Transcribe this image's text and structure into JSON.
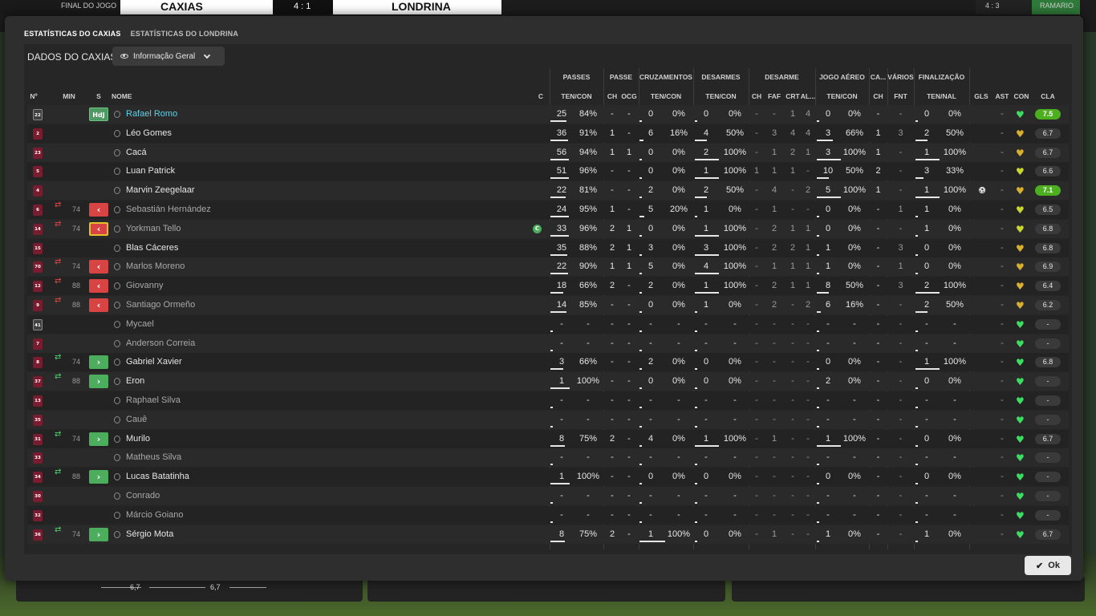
{
  "scoreboard": {
    "label": "FINAL DO JOGO",
    "home": "CAXIAS",
    "score": "4 : 1",
    "away": "LONDRINA",
    "right_label": "RAMARIO",
    "right_score": "4 : 3"
  },
  "tabs": [
    {
      "label": "ESTATÍSTICAS DO CAXIAS",
      "active": true
    },
    {
      "label": "ESTATÍSTICAS DO LONDRINA",
      "active": false
    }
  ],
  "title": "DADOS DO CAXIAS",
  "dropdown": {
    "label": "Informação Geral"
  },
  "groups": {
    "passes": "PASSES",
    "passe": "PASSE",
    "cruzamentos": "CRUZAMENTOS",
    "desarmes": "DESARMES",
    "desarme": "DESARME",
    "jogo_aereo": "JOGO AÉREO",
    "ca": "CA...",
    "varios": "VÁRIOS",
    "finalizacao": "FINALIZAÇÃO"
  },
  "columns": {
    "no": "Nº",
    "min": "MIN",
    "s": "S",
    "nome": "NOME",
    "c": "C",
    "passes_tc": "TEN/CON",
    "passe_ch": "CH",
    "passe_ocg": "OCG",
    "cruz_tc": "TEN/CON",
    "des_tc": "TEN/CON",
    "desarme_ch": "CH",
    "desarme_faf": "FAF",
    "desarme_crt": "CRT",
    "desarme_al": "AL...",
    "aereo_tc": "TEN/CON",
    "ca_ch": "CH",
    "varios_fnt": "FNT",
    "fin_tn": "TEN/NAL",
    "gls": "GLS",
    "ast": "AST",
    "con": "CON",
    "cla": "CLA"
  },
  "players": [
    {
      "no": "22",
      "gk": true,
      "min": "",
      "sub": "",
      "badge": "HdJ",
      "name": "Rafael Romo",
      "style": "hl",
      "cap": false,
      "pt": "25",
      "pp": "84%",
      "pbar": 0.84,
      "pch": "-",
      "pocg": "-",
      "ct": "0",
      "cp": "0%",
      "cbar": 0,
      "dt": "0",
      "dp": "0%",
      "dbar": 0,
      "dch": "-",
      "faf": "-",
      "crt": "1",
      "al": "4",
      "at": "0",
      "ap": "0%",
      "abar": 0,
      "cach": "-",
      "fnt": "-",
      "ft": "0",
      "fp": "0%",
      "fbar": 0,
      "gls": "",
      "ast": "-",
      "heart": "#3ddc62",
      "rating": "7.5",
      "top": true
    },
    {
      "no": "2",
      "gk": false,
      "min": "",
      "sub": "",
      "badge": "",
      "name": "Léo Gomes",
      "style": "",
      "cap": false,
      "pt": "36",
      "pp": "91%",
      "pbar": 0.91,
      "pch": "1",
      "pocg": "-",
      "ct": "6",
      "cp": "16%",
      "cbar": 0.16,
      "dt": "4",
      "dp": "50%",
      "dbar": 0.5,
      "dch": "-",
      "faf": "3",
      "crt": "4",
      "al": "4",
      "at": "3",
      "ap": "66%",
      "abar": 0.66,
      "cach": "1",
      "fnt": "3",
      "ft": "2",
      "fp": "50%",
      "fbar": 0.5,
      "gls": "",
      "ast": "-",
      "heart": "#d8b030",
      "rating": "6.7",
      "top": false
    },
    {
      "no": "23",
      "gk": false,
      "min": "",
      "sub": "",
      "badge": "",
      "name": "Cacá",
      "style": "",
      "cap": false,
      "pt": "56",
      "pp": "94%",
      "pbar": 0.94,
      "pch": "1",
      "pocg": "1",
      "ct": "0",
      "cp": "0%",
      "cbar": 0,
      "dt": "2",
      "dp": "100%",
      "dbar": 1,
      "dch": "-",
      "faf": "1",
      "crt": "2",
      "al": "1",
      "at": "3",
      "ap": "100%",
      "abar": 1,
      "cach": "1",
      "fnt": "-",
      "ft": "1",
      "fp": "100%",
      "fbar": 1,
      "gls": "",
      "ast": "-",
      "heart": "#d8b030",
      "rating": "6.7",
      "top": false
    },
    {
      "no": "5",
      "gk": false,
      "min": "",
      "sub": "",
      "badge": "",
      "name": "Luan Patrick",
      "style": "",
      "cap": false,
      "pt": "51",
      "pp": "96%",
      "pbar": 0.96,
      "pch": "-",
      "pocg": "-",
      "ct": "0",
      "cp": "0%",
      "cbar": 0,
      "dt": "1",
      "dp": "100%",
      "dbar": 1,
      "dch": "1",
      "faf": "1",
      "crt": "1",
      "al": "-",
      "at": "10",
      "ap": "50%",
      "abar": 0.5,
      "cach": "2",
      "fnt": "-",
      "ft": "3",
      "fp": "33%",
      "fbar": 0.33,
      "gls": "",
      "ast": "-",
      "heart": "#c8d830",
      "rating": "6.6",
      "top": false
    },
    {
      "no": "4",
      "gk": false,
      "min": "",
      "sub": "",
      "badge": "",
      "name": "Marvin Zeegelaar",
      "style": "",
      "cap": false,
      "pt": "22",
      "pp": "81%",
      "pbar": 0.81,
      "pch": "-",
      "pocg": "-",
      "ct": "2",
      "cp": "0%",
      "cbar": 0,
      "dt": "2",
      "dp": "50%",
      "dbar": 0.5,
      "dch": "-",
      "faf": "4",
      "crt": "-",
      "al": "2",
      "at": "5",
      "ap": "100%",
      "abar": 1,
      "cach": "1",
      "fnt": "-",
      "ft": "1",
      "fp": "100%",
      "fbar": 1,
      "gls": "ball",
      "ast": "-",
      "heart": "#d8b030",
      "rating": "7.1",
      "top": true
    },
    {
      "no": "6",
      "gk": false,
      "min": "74",
      "sub": "out",
      "badge": "red",
      "name": "Sebastián Hernández",
      "style": "dim",
      "cap": false,
      "pt": "24",
      "pp": "95%",
      "pbar": 0.95,
      "pch": "1",
      "pocg": "-",
      "ct": "5",
      "cp": "20%",
      "cbar": 0.2,
      "dt": "1",
      "dp": "0%",
      "dbar": 0,
      "dch": "-",
      "faf": "1",
      "crt": "-",
      "al": "-",
      "at": "0",
      "ap": "0%",
      "abar": 0,
      "cach": "-",
      "fnt": "1",
      "ft": "1",
      "fp": "0%",
      "fbar": 0,
      "gls": "",
      "ast": "-",
      "heart": "#c8d830",
      "rating": "6.5",
      "top": false
    },
    {
      "no": "14",
      "gk": false,
      "min": "74",
      "sub": "out",
      "badge": "redy",
      "name": "Yorkman Tello",
      "style": "dim",
      "cap": true,
      "pt": "33",
      "pp": "96%",
      "pbar": 0.96,
      "pch": "2",
      "pocg": "1",
      "ct": "0",
      "cp": "0%",
      "cbar": 0,
      "dt": "1",
      "dp": "100%",
      "dbar": 1,
      "dch": "-",
      "faf": "2",
      "crt": "1",
      "al": "1",
      "at": "0",
      "ap": "0%",
      "abar": 0,
      "cach": "-",
      "fnt": "-",
      "ft": "1",
      "fp": "0%",
      "fbar": 0,
      "gls": "",
      "ast": "-",
      "heart": "#c8d830",
      "rating": "6.8",
      "top": false
    },
    {
      "no": "15",
      "gk": false,
      "min": "",
      "sub": "",
      "badge": "",
      "name": "Blas Cáceres",
      "style": "",
      "cap": false,
      "pt": "35",
      "pp": "88%",
      "pbar": 0.88,
      "pch": "2",
      "pocg": "1",
      "ct": "3",
      "cp": "0%",
      "cbar": 0,
      "dt": "3",
      "dp": "100%",
      "dbar": 1,
      "dch": "-",
      "faf": "2",
      "crt": "2",
      "al": "1",
      "at": "1",
      "ap": "0%",
      "abar": 0,
      "cach": "-",
      "fnt": "3",
      "ft": "0",
      "fp": "0%",
      "fbar": 0,
      "gls": "",
      "ast": "-",
      "heart": "#d8b030",
      "rating": "6.8",
      "top": false
    },
    {
      "no": "70",
      "gk": false,
      "min": "74",
      "sub": "out",
      "badge": "red",
      "name": "Marlos Moreno",
      "style": "dim",
      "cap": false,
      "pt": "22",
      "pp": "90%",
      "pbar": 0.9,
      "pch": "1",
      "pocg": "1",
      "ct": "5",
      "cp": "0%",
      "cbar": 0,
      "dt": "4",
      "dp": "100%",
      "dbar": 1,
      "dch": "-",
      "faf": "1",
      "crt": "1",
      "al": "1",
      "at": "1",
      "ap": "0%",
      "abar": 0,
      "cach": "-",
      "fnt": "1",
      "ft": "0",
      "fp": "0%",
      "fbar": 0,
      "gls": "",
      "ast": "-",
      "heart": "#d8b030",
      "rating": "6.9",
      "top": false
    },
    {
      "no": "12",
      "gk": false,
      "min": "88",
      "sub": "out",
      "badge": "red",
      "name": "Giovanny",
      "style": "dim",
      "cap": false,
      "pt": "18",
      "pp": "66%",
      "pbar": 0.66,
      "pch": "2",
      "pocg": "-",
      "ct": "2",
      "cp": "0%",
      "cbar": 0,
      "dt": "1",
      "dp": "100%",
      "dbar": 1,
      "dch": "-",
      "faf": "2",
      "crt": "1",
      "al": "1",
      "at": "8",
      "ap": "50%",
      "abar": 0.5,
      "cach": "-",
      "fnt": "3",
      "ft": "2",
      "fp": "100%",
      "fbar": 1,
      "gls": "",
      "ast": "-",
      "heart": "#d8b030",
      "rating": "6.4",
      "top": false
    },
    {
      "no": "9",
      "gk": false,
      "min": "88",
      "sub": "out",
      "badge": "red",
      "name": "Santiago Ormeño",
      "style": "dim",
      "cap": false,
      "pt": "14",
      "pp": "85%",
      "pbar": 0.85,
      "pch": "-",
      "pocg": "-",
      "ct": "0",
      "cp": "0%",
      "cbar": 0,
      "dt": "1",
      "dp": "0%",
      "dbar": 0,
      "dch": "-",
      "faf": "2",
      "crt": "-",
      "al": "2",
      "at": "6",
      "ap": "16%",
      "abar": 0.16,
      "cach": "-",
      "fnt": "-",
      "ft": "2",
      "fp": "50%",
      "fbar": 0.5,
      "gls": "",
      "ast": "-",
      "heart": "#d8b030",
      "rating": "6.2",
      "top": false
    },
    {
      "no": "41",
      "gk": true,
      "min": "",
      "sub": "",
      "badge": "",
      "name": "Mycael",
      "style": "dim",
      "cap": false,
      "pt": "-",
      "pp": "-",
      "pbar": 0,
      "pch": "-",
      "pocg": "-",
      "ct": "-",
      "cp": "-",
      "cbar": 0,
      "dt": "-",
      "dp": "-",
      "dbar": 0,
      "dch": "-",
      "faf": "-",
      "crt": "-",
      "al": "-",
      "at": "-",
      "ap": "-",
      "abar": 0,
      "cach": "-",
      "fnt": "-",
      "ft": "-",
      "fp": "-",
      "fbar": 0,
      "gls": "",
      "ast": "-",
      "heart": "#3ddc62",
      "rating": "-",
      "top": false
    },
    {
      "no": "7",
      "gk": false,
      "min": "",
      "sub": "",
      "badge": "",
      "name": "Anderson Correia",
      "style": "dim",
      "cap": false,
      "pt": "-",
      "pp": "-",
      "pbar": 0,
      "pch": "-",
      "pocg": "-",
      "ct": "-",
      "cp": "-",
      "cbar": 0,
      "dt": "-",
      "dp": "-",
      "dbar": 0,
      "dch": "-",
      "faf": "-",
      "crt": "-",
      "al": "-",
      "at": "-",
      "ap": "-",
      "abar": 0,
      "cach": "-",
      "fnt": "-",
      "ft": "-",
      "fp": "-",
      "fbar": 0,
      "gls": "",
      "ast": "-",
      "heart": "#3ddc62",
      "rating": "-",
      "top": false
    },
    {
      "no": "8",
      "gk": false,
      "min": "74",
      "sub": "in",
      "badge": "green",
      "name": "Gabriel Xavier",
      "style": "",
      "cap": false,
      "pt": "3",
      "pp": "66%",
      "pbar": 0.66,
      "pch": "-",
      "pocg": "-",
      "ct": "2",
      "cp": "0%",
      "cbar": 0,
      "dt": "0",
      "dp": "0%",
      "dbar": 0,
      "dch": "-",
      "faf": "-",
      "crt": "-",
      "al": "-",
      "at": "0",
      "ap": "0%",
      "abar": 0,
      "cach": "-",
      "fnt": "-",
      "ft": "1",
      "fp": "100%",
      "fbar": 1,
      "gls": "",
      "ast": "-",
      "heart": "#3ddc62",
      "rating": "6.8",
      "top": false
    },
    {
      "no": "37",
      "gk": false,
      "min": "88",
      "sub": "in",
      "badge": "green",
      "name": "Eron",
      "style": "",
      "cap": false,
      "pt": "1",
      "pp": "100%",
      "pbar": 1,
      "pch": "-",
      "pocg": "-",
      "ct": "0",
      "cp": "0%",
      "cbar": 0,
      "dt": "0",
      "dp": "0%",
      "dbar": 0,
      "dch": "-",
      "faf": "-",
      "crt": "-",
      "al": "-",
      "at": "2",
      "ap": "0%",
      "abar": 0,
      "cach": "-",
      "fnt": "-",
      "ft": "0",
      "fp": "0%",
      "fbar": 0,
      "gls": "",
      "ast": "-",
      "heart": "#3ddc62",
      "rating": "-",
      "top": false
    },
    {
      "no": "13",
      "gk": false,
      "min": "",
      "sub": "",
      "badge": "",
      "name": "Raphael Silva",
      "style": "dim",
      "cap": false,
      "pt": "-",
      "pp": "-",
      "pbar": 0,
      "pch": "-",
      "pocg": "-",
      "ct": "-",
      "cp": "-",
      "cbar": 0,
      "dt": "-",
      "dp": "-",
      "dbar": 0,
      "dch": "-",
      "faf": "-",
      "crt": "-",
      "al": "-",
      "at": "-",
      "ap": "-",
      "abar": 0,
      "cach": "-",
      "fnt": "-",
      "ft": "-",
      "fp": "-",
      "fbar": 0,
      "gls": "",
      "ast": "-",
      "heart": "#3ddc62",
      "rating": "-",
      "top": false
    },
    {
      "no": "35",
      "gk": false,
      "min": "",
      "sub": "",
      "badge": "",
      "name": "Cauê",
      "style": "dim",
      "cap": false,
      "pt": "-",
      "pp": "-",
      "pbar": 0,
      "pch": "-",
      "pocg": "-",
      "ct": "-",
      "cp": "-",
      "cbar": 0,
      "dt": "-",
      "dp": "-",
      "dbar": 0,
      "dch": "-",
      "faf": "-",
      "crt": "-",
      "al": "-",
      "at": "-",
      "ap": "-",
      "abar": 0,
      "cach": "-",
      "fnt": "-",
      "ft": "-",
      "fp": "-",
      "fbar": 0,
      "gls": "",
      "ast": "-",
      "heart": "#3ddc62",
      "rating": "-",
      "top": false
    },
    {
      "no": "31",
      "gk": false,
      "min": "74",
      "sub": "in",
      "badge": "green",
      "name": "Murilo",
      "style": "",
      "cap": false,
      "pt": "8",
      "pp": "75%",
      "pbar": 0.75,
      "pch": "2",
      "pocg": "-",
      "ct": "4",
      "cp": "0%",
      "cbar": 0,
      "dt": "1",
      "dp": "100%",
      "dbar": 1,
      "dch": "-",
      "faf": "1",
      "crt": "-",
      "al": "-",
      "at": "1",
      "ap": "100%",
      "abar": 1,
      "cach": "-",
      "fnt": "-",
      "ft": "0",
      "fp": "0%",
      "fbar": 0,
      "gls": "",
      "ast": "-",
      "heart": "#3ddc62",
      "rating": "6.7",
      "top": false
    },
    {
      "no": "33",
      "gk": false,
      "min": "",
      "sub": "",
      "badge": "",
      "name": "Matheus Silva",
      "style": "dim",
      "cap": false,
      "pt": "-",
      "pp": "-",
      "pbar": 0,
      "pch": "-",
      "pocg": "-",
      "ct": "-",
      "cp": "-",
      "cbar": 0,
      "dt": "-",
      "dp": "-",
      "dbar": 0,
      "dch": "-",
      "faf": "-",
      "crt": "-",
      "al": "-",
      "at": "-",
      "ap": "-",
      "abar": 0,
      "cach": "-",
      "fnt": "-",
      "ft": "-",
      "fp": "-",
      "fbar": 0,
      "gls": "",
      "ast": "-",
      "heart": "#3ddc62",
      "rating": "-",
      "top": false
    },
    {
      "no": "34",
      "gk": false,
      "min": "88",
      "sub": "in",
      "badge": "green",
      "name": "Lucas Batatinha",
      "style": "",
      "cap": false,
      "pt": "1",
      "pp": "100%",
      "pbar": 1,
      "pch": "-",
      "pocg": "-",
      "ct": "0",
      "cp": "0%",
      "cbar": 0,
      "dt": "0",
      "dp": "0%",
      "dbar": 0,
      "dch": "-",
      "faf": "-",
      "crt": "-",
      "al": "-",
      "at": "0",
      "ap": "0%",
      "abar": 0,
      "cach": "-",
      "fnt": "-",
      "ft": "0",
      "fp": "0%",
      "fbar": 0,
      "gls": "",
      "ast": "-",
      "heart": "#3ddc62",
      "rating": "-",
      "top": false
    },
    {
      "no": "30",
      "gk": false,
      "min": "",
      "sub": "",
      "badge": "",
      "name": "Conrado",
      "style": "dim",
      "cap": false,
      "pt": "-",
      "pp": "-",
      "pbar": 0,
      "pch": "-",
      "pocg": "-",
      "ct": "-",
      "cp": "-",
      "cbar": 0,
      "dt": "-",
      "dp": "-",
      "dbar": 0,
      "dch": "-",
      "faf": "-",
      "crt": "-",
      "al": "-",
      "at": "-",
      "ap": "-",
      "abar": 0,
      "cach": "-",
      "fnt": "-",
      "ft": "-",
      "fp": "-",
      "fbar": 0,
      "gls": "",
      "ast": "-",
      "heart": "#3ddc62",
      "rating": "-",
      "top": false
    },
    {
      "no": "32",
      "gk": false,
      "min": "",
      "sub": "",
      "badge": "",
      "name": "Márcio Goiano",
      "style": "dim",
      "cap": false,
      "pt": "-",
      "pp": "-",
      "pbar": 0,
      "pch": "-",
      "pocg": "-",
      "ct": "-",
      "cp": "-",
      "cbar": 0,
      "dt": "-",
      "dp": "-",
      "dbar": 0,
      "dch": "-",
      "faf": "-",
      "crt": "-",
      "al": "-",
      "at": "-",
      "ap": "-",
      "abar": 0,
      "cach": "-",
      "fnt": "-",
      "ft": "-",
      "fp": "-",
      "fbar": 0,
      "gls": "",
      "ast": "-",
      "heart": "#3ddc62",
      "rating": "-",
      "top": false
    },
    {
      "no": "36",
      "gk": false,
      "min": "74",
      "sub": "in",
      "badge": "green",
      "name": "Sérgio Mota",
      "style": "",
      "cap": false,
      "pt": "8",
      "pp": "75%",
      "pbar": 0.75,
      "pch": "2",
      "pocg": "-",
      "ct": "1",
      "cp": "100%",
      "cbar": 1,
      "dt": "0",
      "dp": "0%",
      "dbar": 0,
      "dch": "-",
      "faf": "1",
      "crt": "-",
      "al": "-",
      "at": "1",
      "ap": "0%",
      "abar": 0,
      "cach": "-",
      "fnt": "-",
      "ft": "1",
      "fp": "0%",
      "fbar": 0,
      "gls": "",
      "ast": "-",
      "heart": "#3ddc62",
      "rating": "6.7",
      "top": false
    }
  ],
  "bottom_values": [
    "6,7",
    "6,7"
  ],
  "ok_label": "Ok"
}
